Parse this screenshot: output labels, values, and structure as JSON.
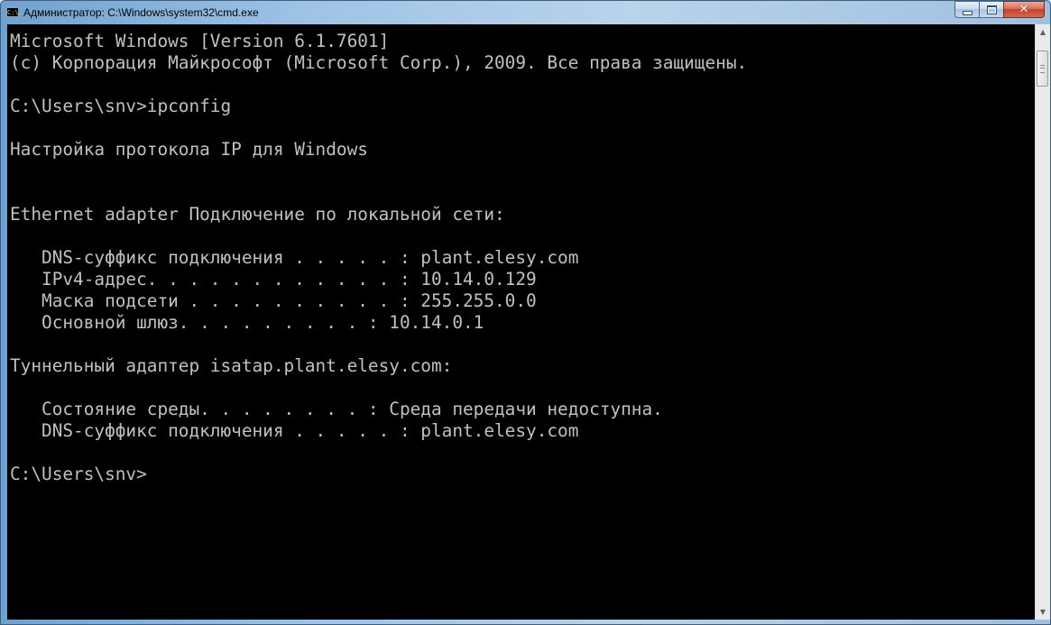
{
  "window": {
    "title": "Администратор: C:\\Windows\\system32\\cmd.exe",
    "icon": "cmd-icon",
    "icon_text": "C:\\."
  },
  "caption_buttons": {
    "minimize": "minimize-icon",
    "maximize": "maximize-icon",
    "close": "close-icon"
  },
  "console": {
    "lines": [
      "Microsoft Windows [Version 6.1.7601]",
      "(c) Корпорация Майкрософт (Microsoft Corp.), 2009. Все права защищены.",
      "",
      "C:\\Users\\snv>ipconfig",
      "",
      "Настройка протокола IP для Windows",
      "",
      "",
      "Ethernet adapter Подключение по локальной сети:",
      "",
      "   DNS-суффикс подключения . . . . . : plant.elesy.com",
      "   IPv4-адрес. . . . . . . . . . . . : 10.14.0.129",
      "   Маска подсети . . . . . . . . . . : 255.255.0.0",
      "   Основной шлюз. . . . . . . . . : 10.14.0.1",
      "",
      "Туннельный адаптер isatap.plant.elesy.com:",
      "",
      "   Состояние среды. . . . . . . . : Среда передачи недоступна.",
      "   DNS-суффикс подключения . . . . . : plant.elesy.com",
      "",
      "C:\\Users\\snv>"
    ],
    "text_color": "#c0c0c0",
    "background_color": "#000000"
  },
  "scrollbar": {
    "up_icon": "scroll-up-arrow-icon",
    "down_icon": "scroll-down-arrow-icon"
  }
}
